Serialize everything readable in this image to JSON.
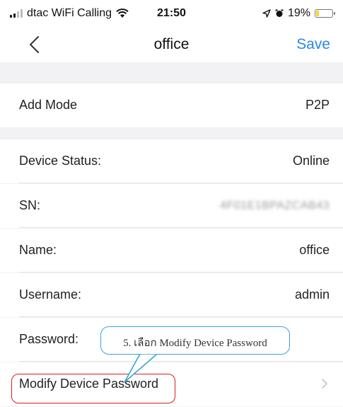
{
  "status_bar": {
    "carrier": "dtac WiFi Calling",
    "time": "21:50",
    "battery_percent": "19%",
    "battery_level": 0.19,
    "battery_color": "#f7d52a"
  },
  "nav": {
    "title": "office",
    "save_label": "Save",
    "accent_color": "#2a86e8"
  },
  "add_mode": {
    "label": "Add Mode",
    "value": "P2P"
  },
  "device_info": [
    {
      "label": "Device Status:",
      "value": "Online"
    },
    {
      "label": "SN:",
      "value": "4F01E1BPAZCAB43"
    },
    {
      "label": "Name:",
      "value": "office"
    },
    {
      "label": "Username:",
      "value": "admin"
    },
    {
      "label": "Password:",
      "value": ""
    }
  ],
  "modify_password": {
    "label": "Modify Device Password"
  },
  "annotation": {
    "callout_text": "5. เลือก Modify Device Password",
    "highlight_color": "#d62020",
    "callout_color": "#3aa3d6"
  }
}
